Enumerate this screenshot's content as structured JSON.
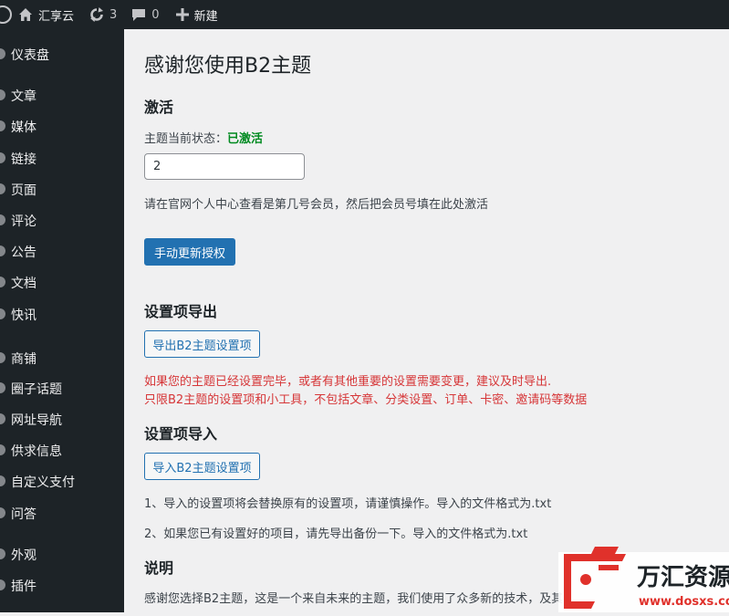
{
  "adminbar": {
    "site_name": "汇享云",
    "updates_count": "3",
    "comments_count": "0",
    "new_label": "新建"
  },
  "sidebar": {
    "items": [
      {
        "label": "仪表盘"
      },
      {
        "label": "文章"
      },
      {
        "label": "媒体"
      },
      {
        "label": "链接"
      },
      {
        "label": "页面"
      },
      {
        "label": "评论"
      },
      {
        "label": "公告"
      },
      {
        "label": "文档"
      },
      {
        "label": "快讯"
      },
      {
        "label": "商铺"
      },
      {
        "label": "圈子话题"
      },
      {
        "label": "网址导航"
      },
      {
        "label": "供求信息"
      },
      {
        "label": "自定义支付"
      },
      {
        "label": "问答"
      },
      {
        "label": "外观"
      },
      {
        "label": "插件"
      }
    ]
  },
  "main": {
    "title": "感谢您使用B2主题",
    "activate": {
      "heading": "激活",
      "status_label": "主题当前状态：",
      "status_value": "已激活",
      "input_value": "2",
      "help": "请在官网个人中心查看是第几号会员，然后把会员号填在此处激活",
      "button": "手动更新授权"
    },
    "export": {
      "heading": "设置项导出",
      "button": "导出B2主题设置项",
      "note1": "如果您的主题已经设置完毕，或者有其他重要的设置需要变更，建议及时导出.",
      "note2": "只限B2主题的设置项和小工具，不包括文章、分类设置、订单、卡密、邀请码等数据"
    },
    "import": {
      "heading": "设置项导入",
      "button": "导入B2主题设置项",
      "note1": "1、导入的设置项将会替换原有的设置项，请谨慎操作。导入的文件格式为.txt",
      "note2": "2、如果您已有设置好的项目，请先导出备份一下。导入的文件格式为.txt"
    },
    "about": {
      "heading": "说明",
      "text": "感谢您选择B2主题，这是一个来自未来的主题，我们使用了众多新的技术，及其"
    }
  },
  "watermark": {
    "brand": "万汇资源网",
    "url": "www.dosxs.com"
  },
  "colors": {
    "admin_dark": "#1d2327",
    "primary": "#2271b1",
    "success": "#008a20",
    "danger": "#d63638",
    "watermark_red": "#e0312b"
  }
}
